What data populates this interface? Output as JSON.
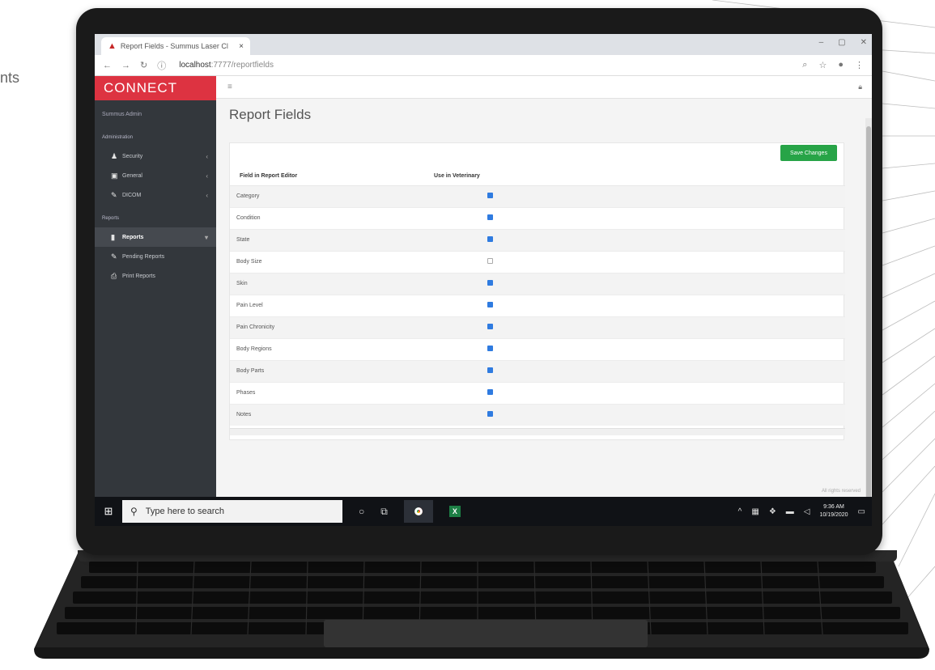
{
  "side_text": "nts",
  "browser": {
    "tab_title": "Report Fields - Summus Laser Cl",
    "tab_close": "×",
    "url_host": "localhost",
    "url_path": ":7777/reportfields",
    "win_min": "–",
    "win_max": "▢",
    "win_close": "✕"
  },
  "sidebar": {
    "brand": "CONNECT",
    "user": "Summus Admin",
    "section_admin": "Administration",
    "items": [
      {
        "label": "Security",
        "icon": "users-icon"
      },
      {
        "label": "General",
        "icon": "building-icon"
      },
      {
        "label": "DICOM",
        "icon": "wrench-icon"
      }
    ],
    "section_reports": "Reports",
    "reports_label": "Reports",
    "subitems": [
      {
        "label": "Pending Reports"
      },
      {
        "label": "Print Reports"
      }
    ]
  },
  "main": {
    "page_title": "Report Fields",
    "save_label": "Save Changes",
    "col_field": "Field in Report Editor",
    "col_use": "Use in Veterinary",
    "rows": [
      {
        "field": "Category",
        "checked": true
      },
      {
        "field": "Condition",
        "checked": true
      },
      {
        "field": "State",
        "checked": true
      },
      {
        "field": "Body Size",
        "checked": false
      },
      {
        "field": "Skin",
        "checked": true
      },
      {
        "field": "Pain Level",
        "checked": true
      },
      {
        "field": "Pain Chronicity",
        "checked": true
      },
      {
        "field": "Body Regions",
        "checked": true
      },
      {
        "field": "Body Parts",
        "checked": true
      },
      {
        "field": "Phases",
        "checked": true
      },
      {
        "field": "Notes",
        "checked": true
      }
    ],
    "footer": "All rights reserved"
  },
  "taskbar": {
    "search_placeholder": "Type here to search",
    "time": "9:36 AM",
    "date": "10/19/2020"
  },
  "colors": {
    "brand": "#dd3341",
    "save_button": "#27a447",
    "checkbox": "#2f7be0",
    "sidebar": "#33373c"
  }
}
